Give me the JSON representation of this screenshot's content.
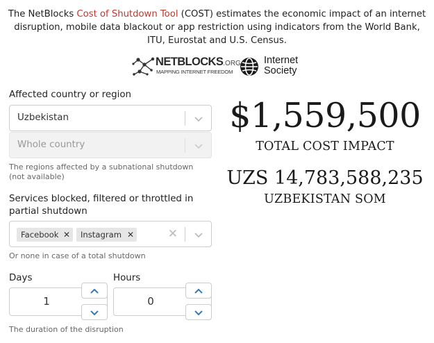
{
  "intro": {
    "text_before": "The NetBlocks ",
    "link": "Cost of Shutdown Tool",
    "text_after": " (COST) estimates the economic impact of an internet disruption, mobile data blackout or app restriction using indicators from the World Bank, ITU, Eurostat and U.S. Census."
  },
  "logos": {
    "netblocks": {
      "name": "NETBLOCKS",
      "suffix": ".ORG",
      "tagline": "MAPPING INTERNET FREEDOM"
    },
    "isoc": {
      "line1": "Internet",
      "line2": "Society"
    }
  },
  "form": {
    "country_label": "Affected country or region",
    "country_value": "Uzbekistan",
    "region_value": "Whole country",
    "region_help": "The regions affected by a subnational shutdown (not available)",
    "services_label": "Services blocked, filtered or throttled in partial shutdown",
    "services_tags": [
      "Facebook",
      "Instagram"
    ],
    "services_help": "Or none in case of a total shutdown",
    "days_label": "Days",
    "days_value": "1",
    "hours_label": "Hours",
    "hours_value": "0",
    "duration_help": "The duration of the disruption"
  },
  "results": {
    "usd_value": "$1,559,500",
    "usd_caption": "TOTAL COST IMPACT",
    "local_value": "UZS 14,783,588,235",
    "local_caption": "UZBEKISTAN SOM"
  },
  "colors": {
    "link": "#c0392b",
    "text": "#222222",
    "border": "#cccccc"
  },
  "icons": [
    "network-graph-icon",
    "globe-icon",
    "chevron-down-icon",
    "remove-tag-icon",
    "clear-icon",
    "chevron-up-icon"
  ]
}
